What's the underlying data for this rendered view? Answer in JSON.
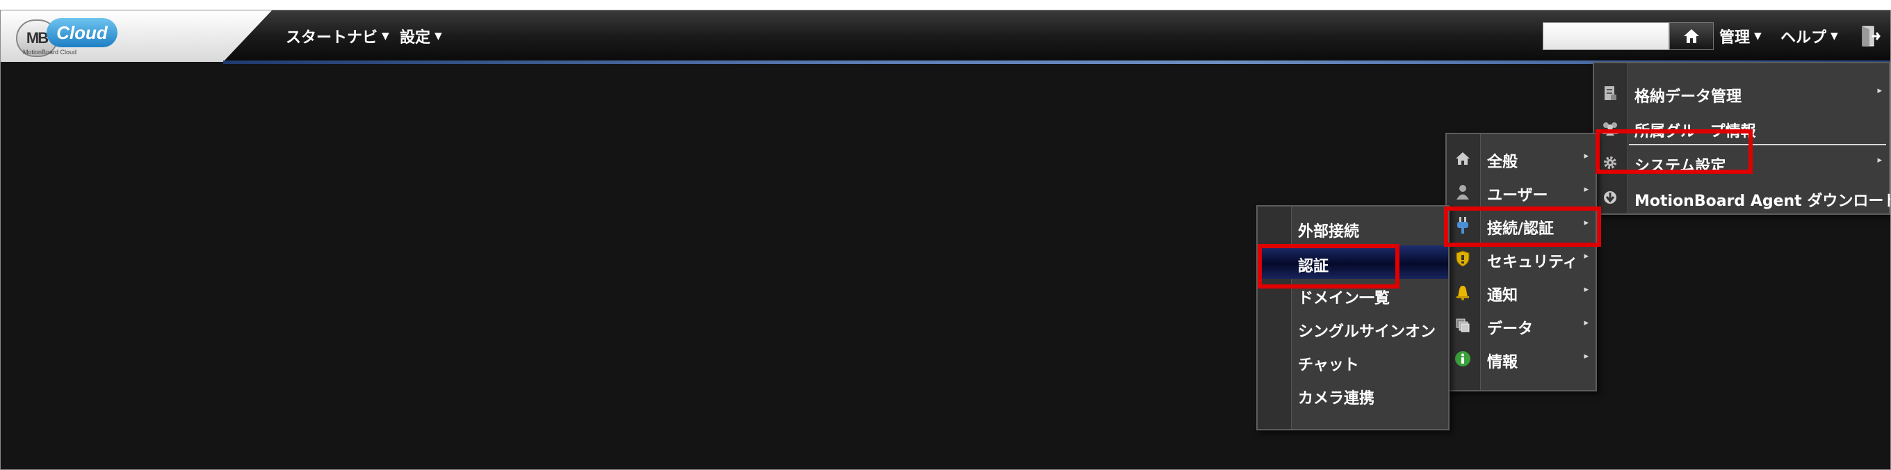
{
  "brand": {
    "logo_mb": "MB",
    "logo_cloud": "Cloud",
    "logo_sub": "MotionBoard Cloud"
  },
  "topnav": {
    "start_navi": "スタートナビ",
    "settings": "設定",
    "admin": "管理",
    "help": "ヘルプ",
    "caret": "▼"
  },
  "admin_menu": {
    "items": [
      {
        "label": "格納データ管理",
        "icon": "storage-icon",
        "arrow": "▸"
      },
      {
        "label": "所属グループ情報",
        "icon": "group-icon",
        "arrow": ""
      },
      {
        "label": "システム設定",
        "icon": "gear-icon",
        "arrow": "▸"
      },
      {
        "label": "MotionBoard Agent ダウンロード",
        "icon": "download-icon",
        "arrow": ""
      }
    ]
  },
  "system_menu": {
    "items": [
      {
        "label": "全般",
        "icon": "home-icon",
        "arrow": "▸"
      },
      {
        "label": "ユーザー",
        "icon": "user-icon",
        "arrow": "▸"
      },
      {
        "label": "接続/認証",
        "icon": "plug-icon",
        "arrow": "▸"
      },
      {
        "label": "セキュリティ",
        "icon": "shield-icon",
        "arrow": "▸"
      },
      {
        "label": "通知",
        "icon": "bell-icon",
        "arrow": "▸"
      },
      {
        "label": "データ",
        "icon": "data-icon",
        "arrow": "▸"
      },
      {
        "label": "情報",
        "icon": "info-icon",
        "arrow": "▸"
      }
    ]
  },
  "connection_menu": {
    "items": [
      {
        "label": "外部接続"
      },
      {
        "label": "認証"
      },
      {
        "label": "ドメイン一覧"
      },
      {
        "label": "シングルサインオン"
      },
      {
        "label": "チャット"
      },
      {
        "label": "カメラ連携"
      }
    ]
  },
  "colors": {
    "highlight": "#e00000",
    "selected_bg": "#0a1240",
    "menu_bg": "#3c3c3c"
  }
}
